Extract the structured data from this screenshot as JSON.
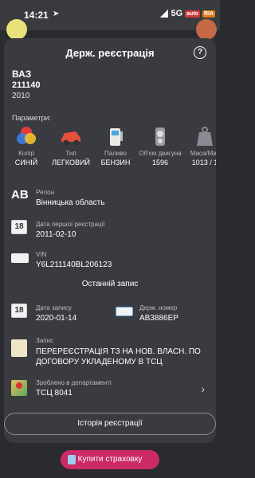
{
  "status_bar": {
    "time": "14:21",
    "network": "5G",
    "badge_auto": "auto",
    "badge_ria": "RIA"
  },
  "card": {
    "title": "Держ. реєстрація",
    "help_icon": "?",
    "vehicle": {
      "make": "ВАЗ",
      "model": "211140",
      "year": "2010"
    },
    "params_label": "Параметри:",
    "params": [
      {
        "icon": "color-icon",
        "name": "Колір",
        "value": "СИНІЙ"
      },
      {
        "icon": "car-type-icon",
        "name": "Тип",
        "value": "ЛЕГКОВИЙ"
      },
      {
        "icon": "fuel-icon",
        "name": "Паливо",
        "value": "БЕНЗИН"
      },
      {
        "icon": "engine-icon",
        "name": "Об'єм двигуна",
        "value": "1596"
      },
      {
        "icon": "weight-icon",
        "name": "Маса/Мак",
        "value": "1013 / 1"
      }
    ],
    "region": {
      "icon_text": "AB",
      "label": "Регіон",
      "value": "Вінницька область"
    },
    "first_registration": {
      "icon_text": "18",
      "label": "Дата першої реєстрації",
      "value": "2011-02-10"
    },
    "vin": {
      "label": "VIN",
      "value": "Y6L211140BL206123"
    },
    "last_record_title": "Останній запис",
    "record_date": {
      "icon_text": "18",
      "label": "Дата запису",
      "value": "2020-01-14"
    },
    "plate": {
      "label": "Держ. номер",
      "value": "АВ3886ЕР"
    },
    "record": {
      "label": "Запис",
      "value": "ПЕРЕРЕЄСТРАЦІЯ ТЗ НА НОВ. ВЛАСН. ПО ДОГОВОРУ УКЛАДЕНОМУ В ТСЦ"
    },
    "department": {
      "label": "Зроблено в департаменті",
      "value": "ТСЦ 8041"
    },
    "history_button": "Історія реєстрації"
  },
  "insurance_button": "Купити страховку",
  "colors": {
    "background": "#2a2b2f",
    "card": "#3a3b40",
    "accent": "#cc2a66"
  }
}
